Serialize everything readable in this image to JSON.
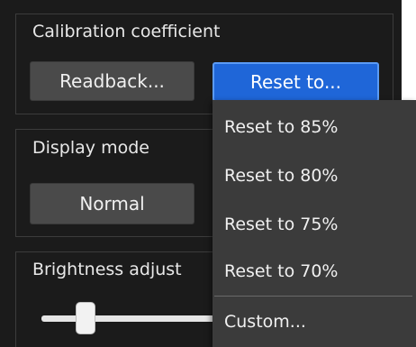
{
  "calibration": {
    "title": "Calibration coefficient",
    "readback_label": "Readback...",
    "reset_label": "Reset to..."
  },
  "display_mode": {
    "title": "Display mode",
    "value_label": "Normal"
  },
  "brightness": {
    "title": "Brightness adjust",
    "level": 0.12
  },
  "reset_menu": {
    "items": [
      {
        "label": "Reset to 85%"
      },
      {
        "label": "Reset to 80%"
      },
      {
        "label": "Reset to 75%"
      },
      {
        "label": "Reset to 70%"
      }
    ],
    "custom_label": "Custom..."
  },
  "colors": {
    "accent": "#1f66d8",
    "panel_bg": "#1b1b1b",
    "menu_bg": "#3b3b3b"
  }
}
